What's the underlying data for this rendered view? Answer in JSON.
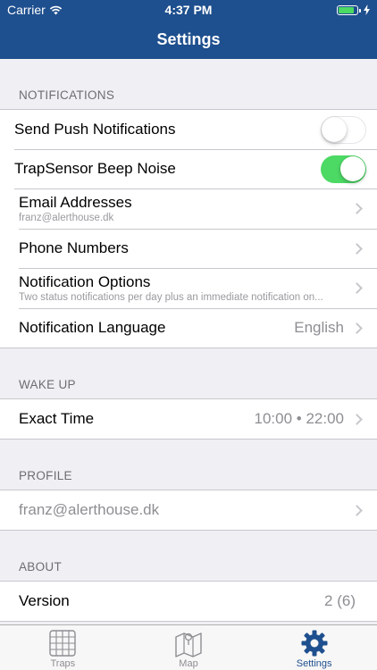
{
  "status_bar": {
    "carrier": "Carrier",
    "time": "4:37 PM"
  },
  "nav": {
    "title": "Settings"
  },
  "sections": {
    "notifications": {
      "header": "NOTIFICATIONS",
      "push": {
        "label": "Send Push Notifications",
        "enabled": false
      },
      "beep": {
        "label": "TrapSensor Beep Noise",
        "enabled": true
      },
      "email": {
        "label": "Email Addresses",
        "subtitle": "franz@alerthouse.dk"
      },
      "phone": {
        "label": "Phone Numbers"
      },
      "options": {
        "label": "Notification Options",
        "subtitle": "Two status notifications per day plus an immediate notification on..."
      },
      "language": {
        "label": "Notification Language",
        "value": "English"
      }
    },
    "wake_up": {
      "header": "WAKE UP",
      "exact_time": {
        "label": "Exact Time",
        "value": "10:00 • 22:00"
      }
    },
    "profile": {
      "header": "PROFILE",
      "email": {
        "label": "franz@alerthouse.dk"
      }
    },
    "about": {
      "header": "ABOUT",
      "version": {
        "label": "Version",
        "value": "2 (6)"
      }
    }
  },
  "tabs": [
    {
      "label": "Traps",
      "icon": "grid-icon"
    },
    {
      "label": "Map",
      "icon": "map-icon"
    },
    {
      "label": "Settings",
      "icon": "gear-icon",
      "active": true
    }
  ],
  "colors": {
    "nav_bar": "#1e4f8e",
    "toggle_on": "#4cd964",
    "tab_active": "#1e4f8e",
    "tab_inactive": "#8e8e93"
  }
}
